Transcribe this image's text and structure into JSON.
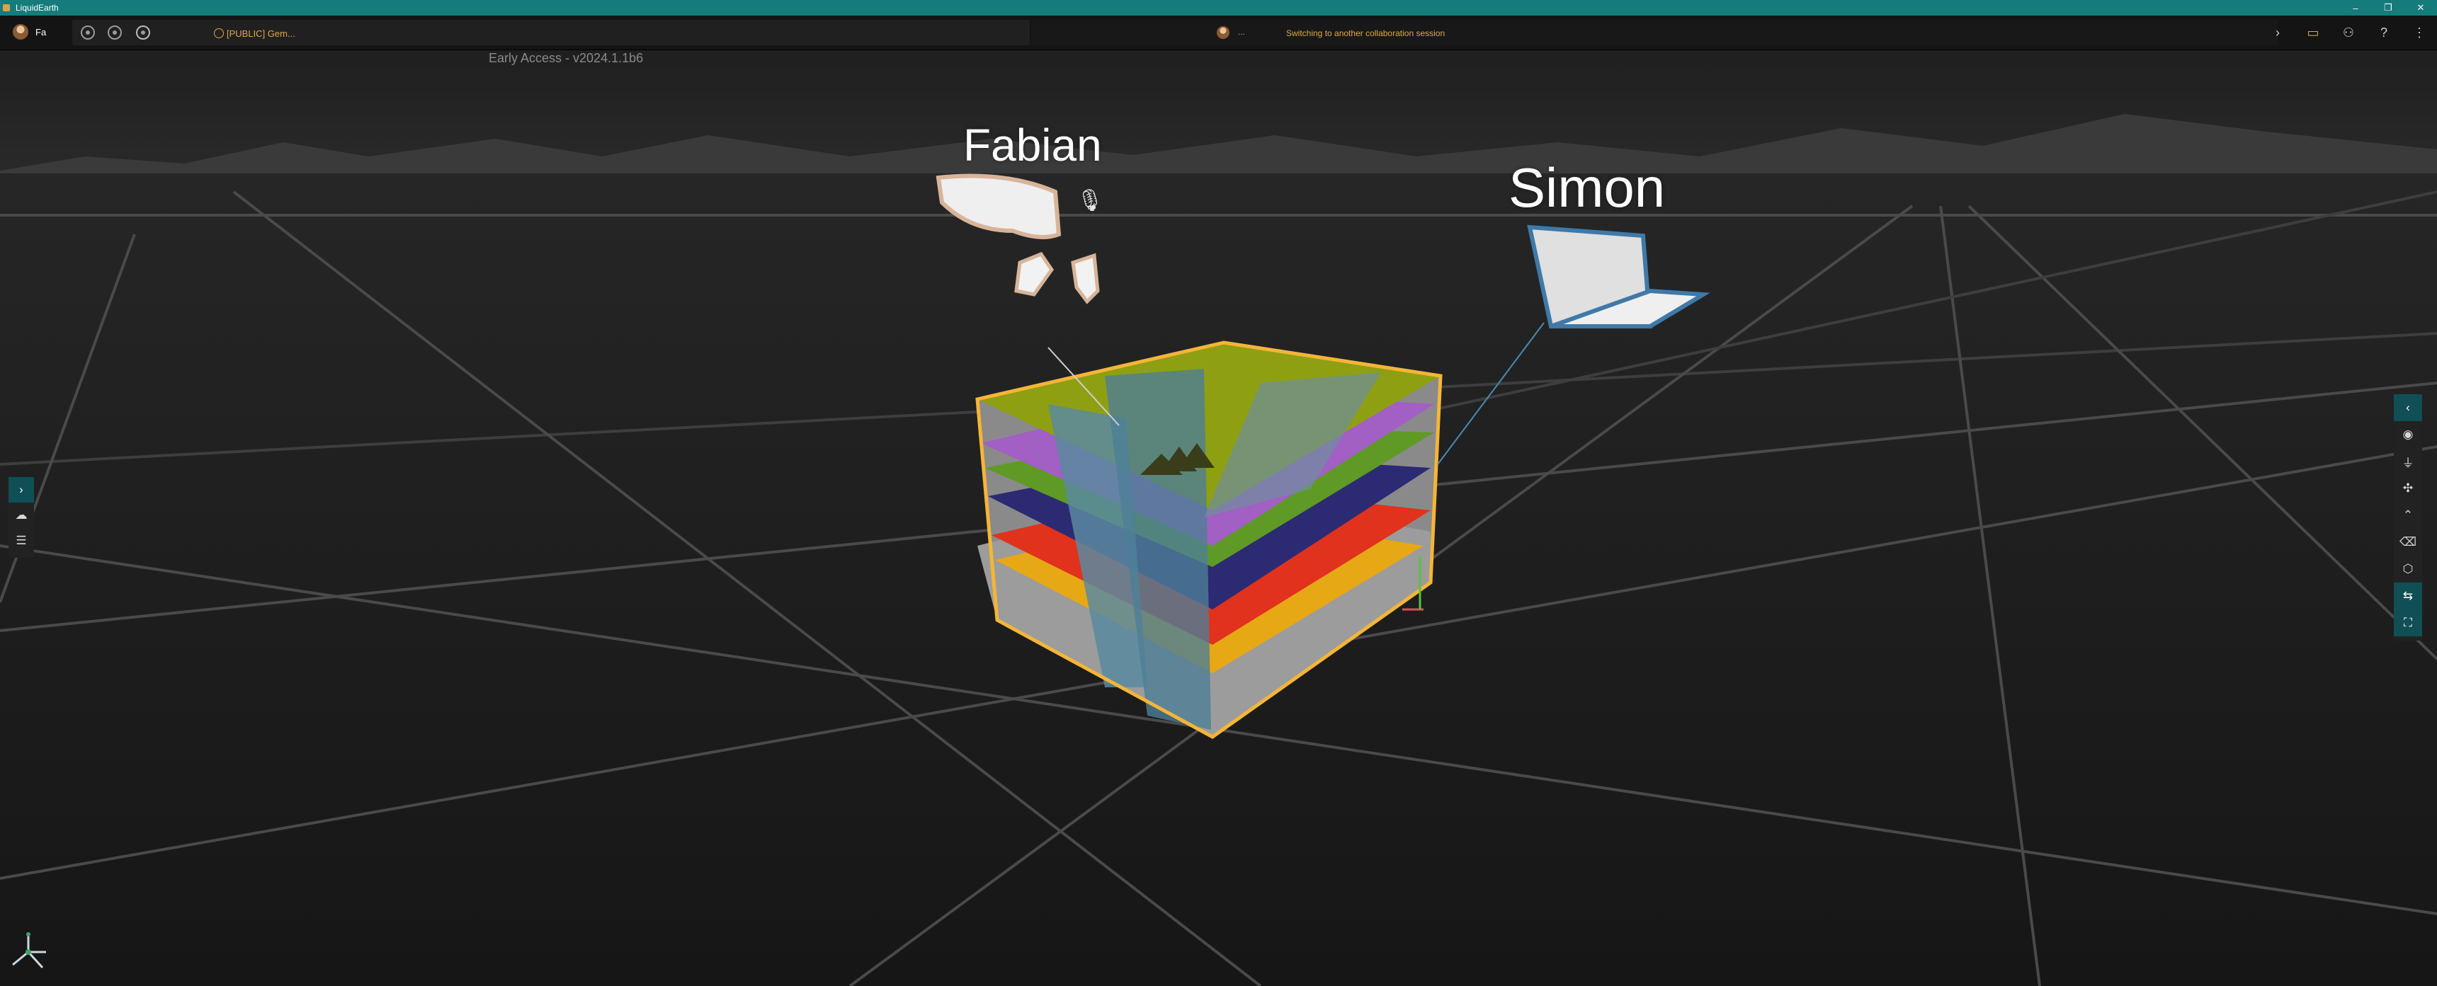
{
  "window": {
    "title": "LiquidEarth",
    "controls": [
      "–",
      "❐",
      "✕"
    ]
  },
  "toolbar": {
    "user_label": "Fa",
    "session_name": "[PUBLIC] Gem...",
    "collab_participant_initial": "...",
    "collab_message": "Switching to another collaboration session",
    "right_icons": [
      "chevron-right-icon",
      "video-icon",
      "users-icon",
      "help-icon",
      "more-vertical-icon"
    ]
  },
  "version_text": "Early Access - v2024.1.1b6",
  "participants": [
    {
      "name": "Fabian",
      "device": "vr-headset"
    },
    {
      "name": "Simon",
      "device": "laptop"
    }
  ],
  "left_panel": {
    "buttons": [
      "chevron-right-icon",
      "cloud-icon",
      "list-icon"
    ]
  },
  "right_panel": {
    "buttons": [
      "chevron-left-icon",
      "eye-icon",
      "hierarchy-icon",
      "orbit-icon",
      "collapse-up-icon",
      "erase-icon",
      "cube-icon",
      "split-icon",
      "fullscreen-icon"
    ]
  },
  "colors": {
    "accent": "#e2a64a",
    "titlebar": "#167b7b",
    "selection": "#f5b537"
  }
}
